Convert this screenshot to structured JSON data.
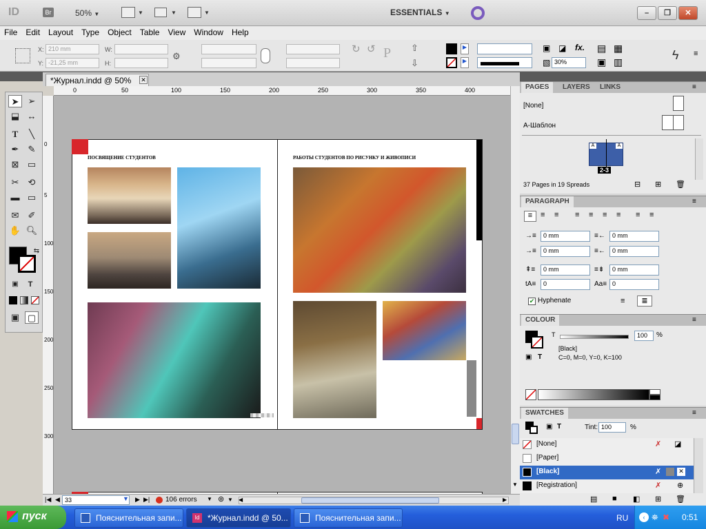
{
  "app": {
    "logo": "ID",
    "bridge": "Br",
    "zoom": "50%",
    "workspace": "ESSENTIALS",
    "window_buttons": [
      "–",
      "❐",
      "✕"
    ]
  },
  "menu": [
    "File",
    "Edit",
    "Layout",
    "Type",
    "Object",
    "Table",
    "View",
    "Window",
    "Help"
  ],
  "control": {
    "x_label": "X:",
    "x_value": "210 mm",
    "y_label": "Y:",
    "y_value": "-21,25 mm",
    "w_label": "W:",
    "h_label": "H:",
    "opacity": "30%"
  },
  "document": {
    "tab_title": "*Журнал.indd @ 50%",
    "ruler_ticks": [
      "0",
      "50",
      "100",
      "150",
      "200",
      "250",
      "300",
      "350",
      "400"
    ],
    "ruler_v_ticks": [
      "0",
      "5",
      "100",
      "150",
      "200",
      "250",
      "300"
    ],
    "left_heading": "ПОСВЯЩЕНИЕ СТУДЕНТОВ",
    "right_heading": "РАБОТЫ СТУДЕНТОВ ПО РИСУНКУ И ЖИВОПИСИ",
    "page_field": "33",
    "errors": "106 errors"
  },
  "pages_panel": {
    "tabs": [
      "PAGES",
      "LAYERS",
      "LINKS"
    ],
    "masters": [
      "[None]",
      "А-Шаблон"
    ],
    "spread_label": "2-3",
    "summary": "37 Pages in 19 Spreads"
  },
  "paragraph_panel": {
    "title": "PARAGRAPH",
    "indent_left": "0 mm",
    "indent_right": "0 mm",
    "first_line": "0 mm",
    "last_line": "0 mm",
    "space_before": "0 mm",
    "space_after": "0 mm",
    "drop_lines": "0",
    "drop_chars": "0",
    "hyphenate": "Hyphenate"
  },
  "colour_panel": {
    "title": "COLOUR",
    "t_label": "T",
    "tint": "100",
    "pct": "%",
    "swatch_name": "[Black]",
    "cmyk": "C=0, M=0, Y=0, K=100"
  },
  "swatches_panel": {
    "title": "SWATCHES",
    "tint_label": "Tint:",
    "tint": "100",
    "pct": "%",
    "items": [
      "[None]",
      "[Paper]",
      "[Black]",
      "[Registration]"
    ],
    "selected_index": 2
  },
  "taskbar": {
    "start": "пуск",
    "buttons": [
      "Пояснительная запи...",
      "*Журнал.indd @ 50...",
      "Пояснительная запи..."
    ],
    "active_index": 1,
    "lang": "RU",
    "clock": "0:51"
  },
  "colors": {
    "accent_red": "#d8262b",
    "selection_blue": "#316ac5",
    "taskbar_blue": "#245edb"
  }
}
